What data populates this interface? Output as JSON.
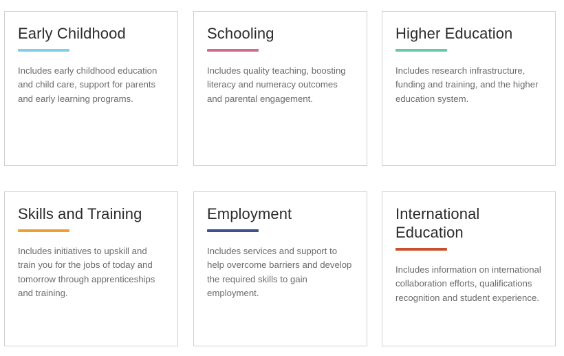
{
  "cards": [
    {
      "title": "Early Childhood",
      "accent": "#7fd0e6",
      "description": "Includes early childhood education and child care, support for parents and early learning programs."
    },
    {
      "title": "Schooling",
      "accent": "#cf6b8e",
      "description": "Includes quality teaching, boosting literacy and numeracy outcomes and parental engagement."
    },
    {
      "title": "Higher Education",
      "accent": "#66c9a3",
      "description": "Includes research infrastructure, funding and training, and the higher education system."
    },
    {
      "title": "Skills and Training",
      "accent": "#f0a030",
      "description": "Includes initiatives to upskill and train you for the jobs of today and tomorrow through apprenticeships and training."
    },
    {
      "title": "Employment",
      "accent": "#3f4f8f",
      "description": "Includes services and support to help overcome barriers and develop the required skills to gain employment."
    },
    {
      "title": "International Education",
      "accent": "#c8512b",
      "description": "Includes information on international collaboration efforts, qualifications recognition and student experience."
    }
  ]
}
